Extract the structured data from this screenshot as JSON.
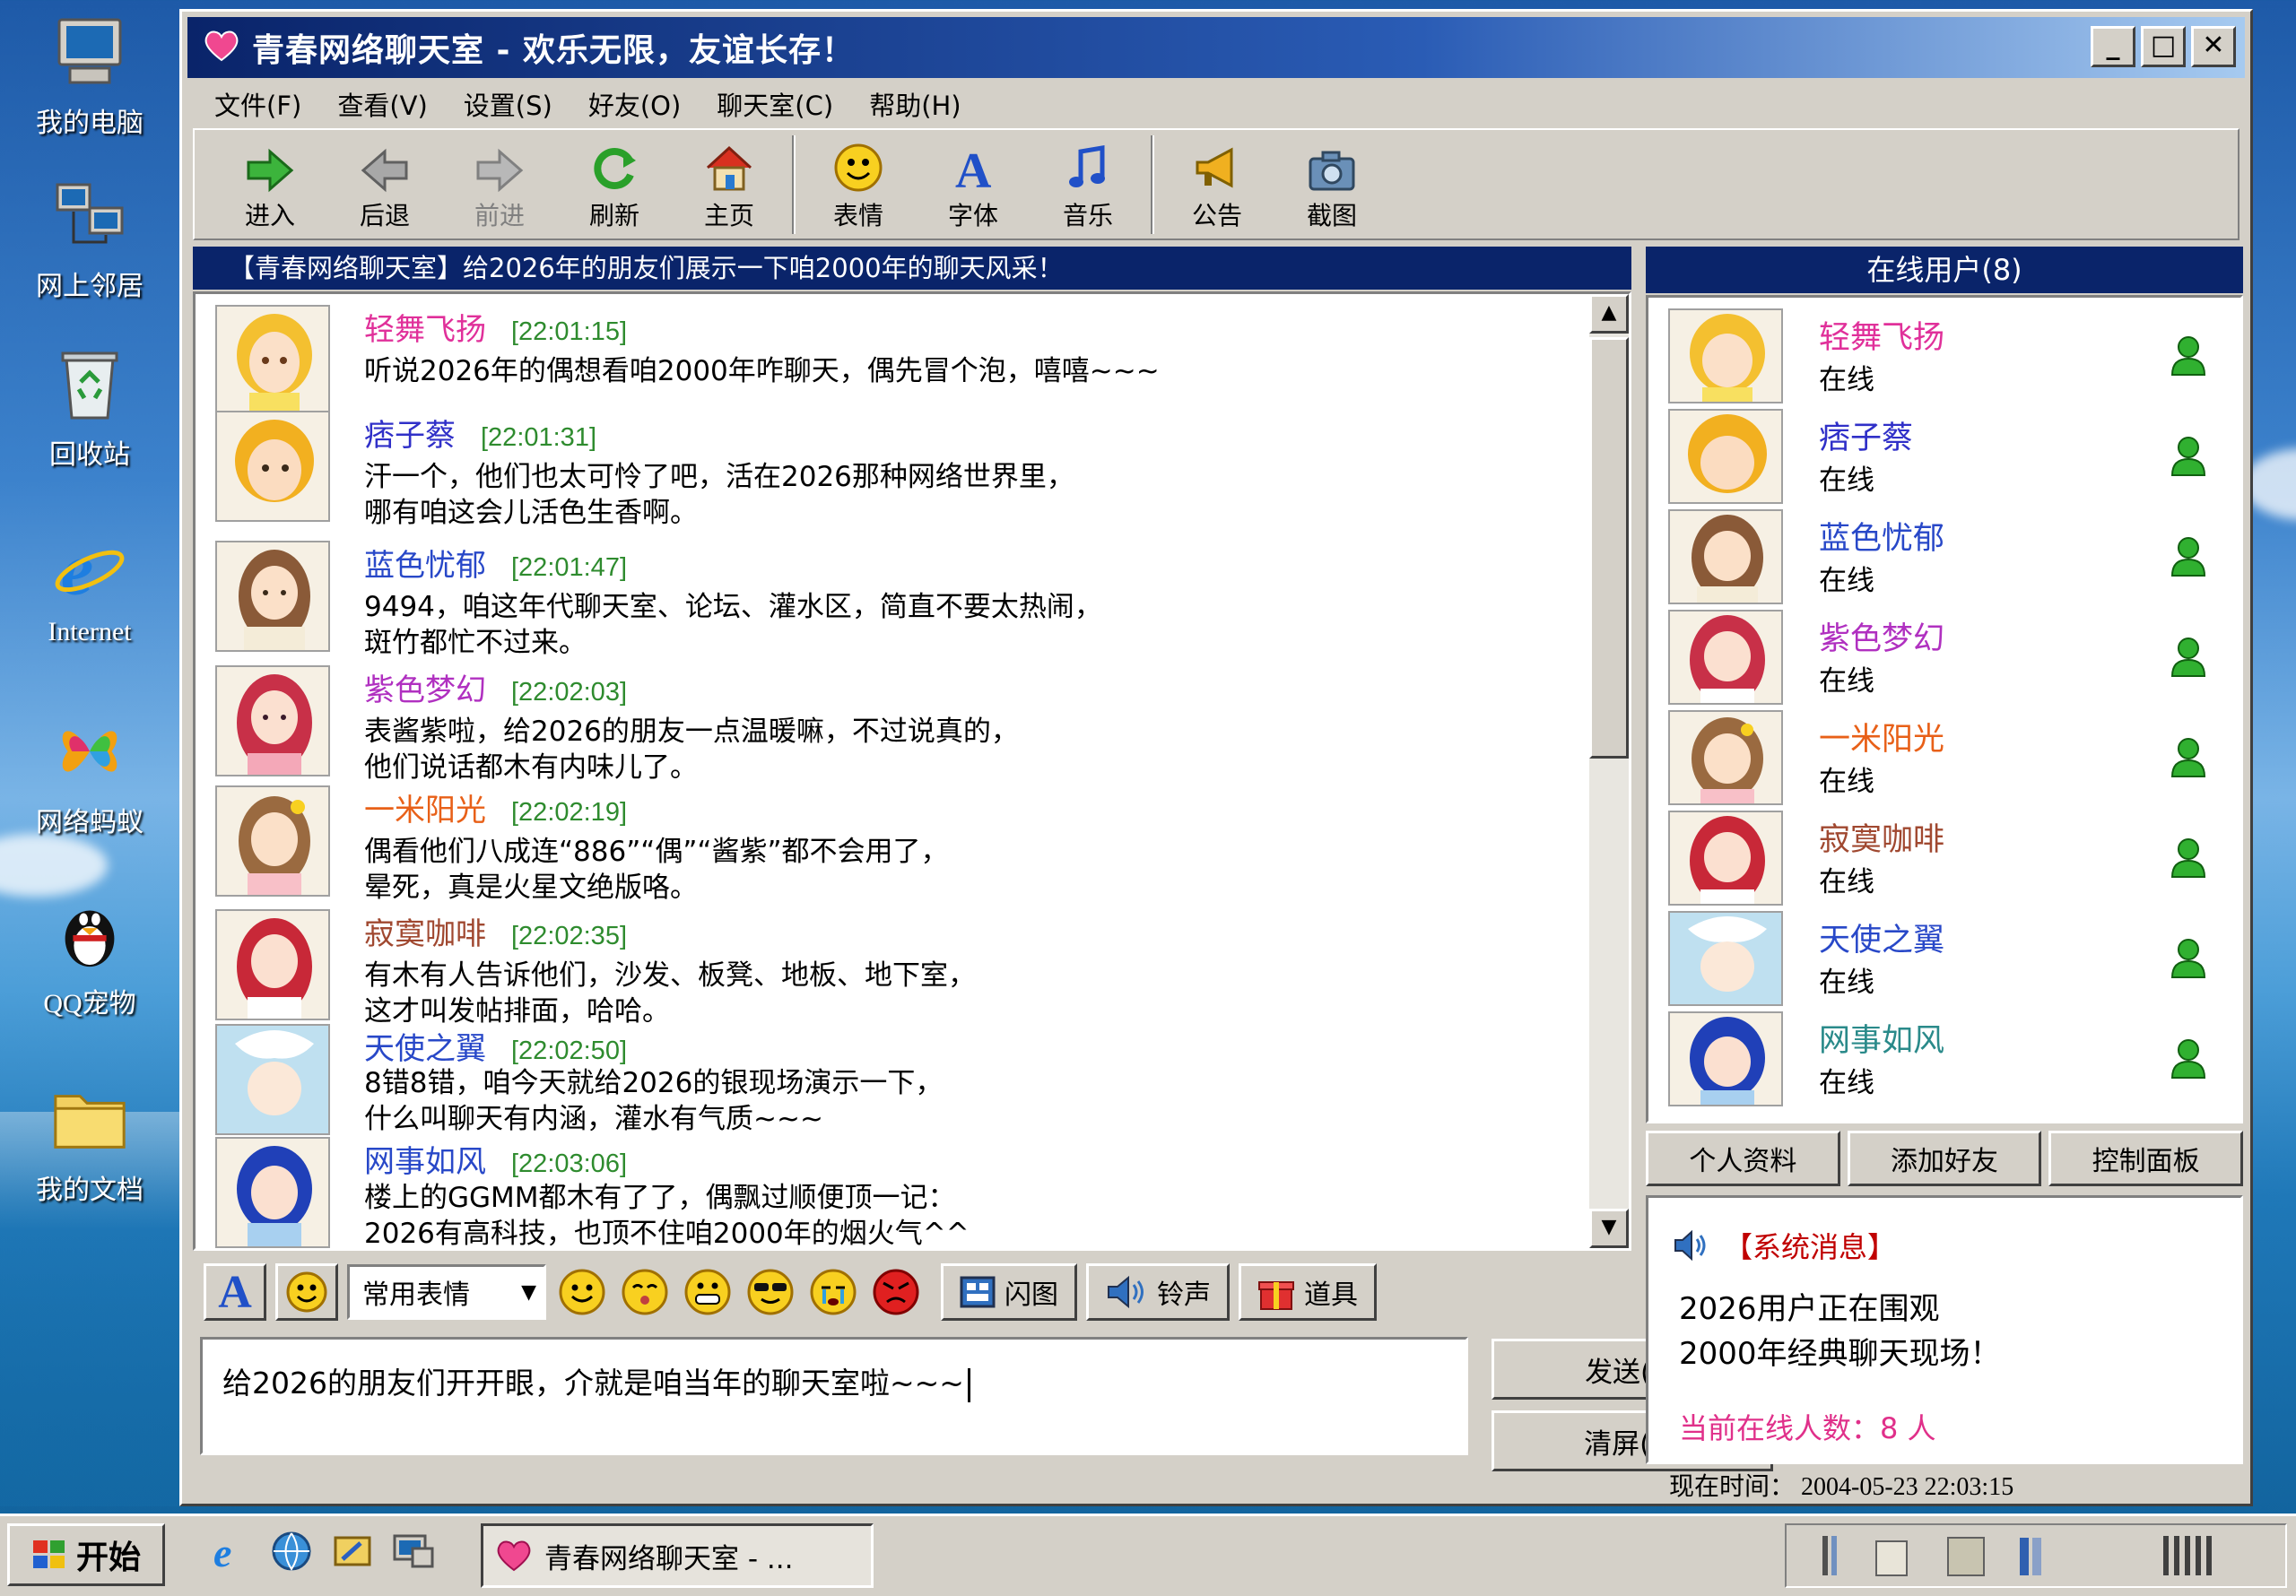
{
  "desktop": {
    "icons": [
      {
        "label": "我的电脑",
        "icon": "my-computer-icon"
      },
      {
        "label": "网上邻居",
        "icon": "network-places-icon"
      },
      {
        "label": "回收站",
        "icon": "recycle-bin-icon"
      },
      {
        "label": "Internet",
        "icon": "internet-explorer-icon"
      },
      {
        "label": "网络蚂蚁",
        "icon": "netants-icon"
      },
      {
        "label": "QQ宠物",
        "icon": "qq-pet-icon"
      },
      {
        "label": "我的文档",
        "icon": "my-documents-icon"
      }
    ]
  },
  "window": {
    "title": "青春网络聊天室 - 欢乐无限，友谊长存！",
    "controls": {
      "minimize": "_",
      "maximize": "□",
      "close": "✕"
    }
  },
  "menu": [
    "文件(F)",
    "查看(V)",
    "设置(S)",
    "好友(O)",
    "聊天室(C)",
    "帮助(H)"
  ],
  "toolbar": [
    {
      "label": "进入",
      "icon": "enter-arrow-icon"
    },
    {
      "label": "后退",
      "icon": "back-arrow-icon"
    },
    {
      "label": "前进",
      "icon": "forward-arrow-icon"
    },
    {
      "label": "刷新",
      "icon": "refresh-icon"
    },
    {
      "label": "主页",
      "icon": "home-icon"
    },
    {
      "label": "表情",
      "icon": "smiley-icon"
    },
    {
      "label": "字体",
      "icon": "font-icon"
    },
    {
      "label": "音乐",
      "icon": "music-note-icon"
    },
    {
      "label": "公告",
      "icon": "megaphone-icon"
    },
    {
      "label": "截图",
      "icon": "camera-icon"
    }
  ],
  "chat": {
    "header": "【青春网络聊天室】给2026年的朋友们展示一下咱2000年的聊天风采！",
    "messages": [
      {
        "name": "轻舞飞扬",
        "time": "[22:01:15]",
        "color": "#e0309a",
        "lines": [
          "听说2026年的偶想看咱2000年咋聊天，偶先冒个泡，嘻嘻~~~"
        ]
      },
      {
        "name": "痞子蔡",
        "time": "[22:01:31]",
        "color": "#3030c8",
        "lines": [
          "汗一个，他们也太可怜了吧，活在2026那种网络世界里，",
          "哪有咱这会儿活色生香啊。"
        ]
      },
      {
        "name": "蓝色忧郁",
        "time": "[22:01:47]",
        "color": "#2848c8",
        "lines": [
          "9494，咱这年代聊天室、论坛、灌水区，简直不要太热闹，",
          "斑竹都忙不过来。"
        ]
      },
      {
        "name": "紫色梦幻",
        "time": "[22:02:03]",
        "color": "#b030c0",
        "lines": [
          "表酱紫啦，给2026的朋友一点温暖嘛，不过说真的，",
          "他们说话都木有内味儿了。"
        ]
      },
      {
        "name": "一米阳光",
        "time": "[22:02:19]",
        "color": "#e86018",
        "lines": [
          "偶看他们八成连“886”“偶”“酱紫”都不会用了，",
          "晕死，真是火星文绝版咯。"
        ]
      },
      {
        "name": "寂寞咖啡",
        "time": "[22:02:35]",
        "color": "#a04830",
        "lines": [
          "有木有人告诉他们，沙发、板凳、地板、地下室，",
          "这才叫发帖排面，哈哈。"
        ]
      },
      {
        "name": "天使之翼",
        "time": "[22:02:50]",
        "color": "#2848c8",
        "lines": [
          "8错8错，咱今天就给2026的银现场演示一下，",
          "什么叫聊天有内涵，灌水有气质~~~"
        ]
      },
      {
        "name": "网事如风",
        "time": "[22:03:06]",
        "color": "#2848c8",
        "lines": [
          "楼上的GGMM都木有了了，偶飘过顺便顶一记：",
          "2026有高科技，也顶不住咱2000年的烟火气^^"
        ]
      }
    ]
  },
  "input_toolbar": {
    "font_btn": "A",
    "emoji_select": "常用表情",
    "flash_img": "闪图",
    "ringtone": "铃声",
    "props": "道具"
  },
  "input": {
    "text": "给2026的朋友们开开眼，介就是咱当年的聊天室啦~~~",
    "send": "发送(S)",
    "clear": "清屏(C)"
  },
  "users": {
    "header": "在线用户(8)",
    "list": [
      {
        "name": "轻舞飞扬",
        "status": "在线",
        "color": "#e0309a"
      },
      {
        "name": "痞子蔡",
        "status": "在线",
        "color": "#3030c8"
      },
      {
        "name": "蓝色忧郁",
        "status": "在线",
        "color": "#2848c8"
      },
      {
        "name": "紫色梦幻",
        "status": "在线",
        "color": "#b030c0"
      },
      {
        "name": "一米阳光",
        "status": "在线",
        "color": "#e86018"
      },
      {
        "name": "寂寞咖啡",
        "status": "在线",
        "color": "#a04830"
      },
      {
        "name": "天使之翼",
        "status": "在线",
        "color": "#2848c8"
      },
      {
        "name": "网事如风",
        "status": "在线",
        "color": "#2a8a8a"
      }
    ],
    "buttons": [
      "个人资料",
      "添加好友",
      "控制面板"
    ]
  },
  "system": {
    "title": "【系统消息】",
    "lines": [
      "2026用户正在围观",
      "2000年经典聊天现场！"
    ],
    "online_count": "当前在线人数：8 人"
  },
  "status": {
    "time": "现在时间：  2004-05-23   22:03:15"
  },
  "taskbar": {
    "start": "开始",
    "task": "青春网络聊天室 - ..."
  }
}
